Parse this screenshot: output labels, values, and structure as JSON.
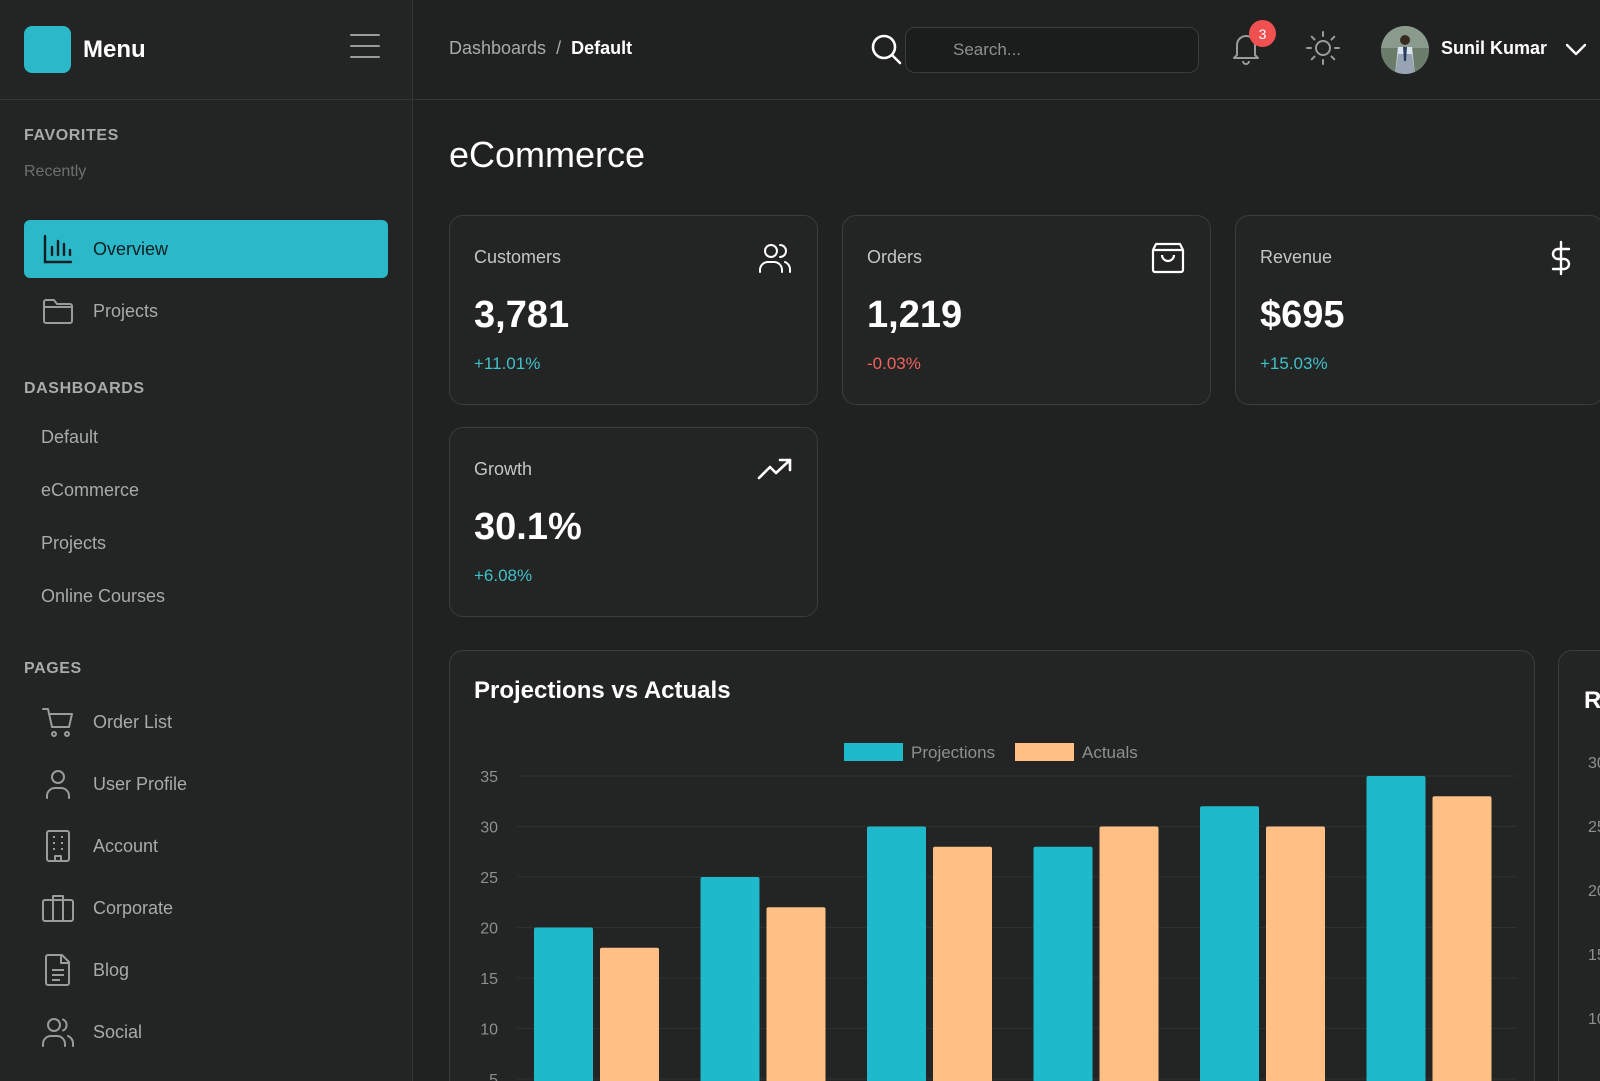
{
  "sidebar": {
    "title": "Menu",
    "favorites": {
      "label": "FAVORITES",
      "sub": "Recently"
    },
    "top_items": [
      {
        "label": "Overview",
        "icon": "bar-chart-icon"
      },
      {
        "label": "Projects",
        "icon": "folder-icon"
      }
    ],
    "dashboards": {
      "label": "DASHBOARDS",
      "items": [
        "Default",
        "eCommerce",
        "Projects",
        "Online Courses"
      ]
    },
    "pages": {
      "label": "PAGES",
      "items": [
        {
          "label": "Order List",
          "icon": "cart-icon"
        },
        {
          "label": "User Profile",
          "icon": "user-icon"
        },
        {
          "label": "Account",
          "icon": "building-icon"
        },
        {
          "label": "Corporate",
          "icon": "briefcase-icon"
        },
        {
          "label": "Blog",
          "icon": "document-icon"
        },
        {
          "label": "Social",
          "icon": "users-icon"
        }
      ]
    }
  },
  "header": {
    "breadcrumb": {
      "parent": "Dashboards",
      "separator": "/",
      "current": "Default"
    },
    "search_placeholder": "Search...",
    "notification_count": "3",
    "user_name": "Sunil Kumar"
  },
  "main": {
    "title": "eCommerce",
    "cards": [
      {
        "label": "Customers",
        "value": "3,781",
        "change": "+11.01%",
        "trend": "up",
        "icon": "users-icon"
      },
      {
        "label": "Orders",
        "value": "1,219",
        "change": "-0.03%",
        "trend": "down",
        "icon": "shopping-bag-icon"
      },
      {
        "label": "Revenue",
        "value": "$695",
        "change": "+15.03%",
        "trend": "up",
        "icon": "dollar-icon"
      },
      {
        "label": "Growth",
        "value": "30.1%",
        "change": "+6.08%",
        "trend": "up",
        "icon": "trending-up-icon"
      }
    ],
    "side_card": {
      "title": "R",
      "ticks": [
        "30",
        "25",
        "20",
        "15",
        "10"
      ]
    }
  },
  "colors": {
    "accent": "#2bb8c8",
    "projections": "#1fb9cc",
    "actuals": "#ffbf85",
    "positive": "#3fc1c9",
    "negative": "#f0625a"
  },
  "chart_data": {
    "type": "bar",
    "title": "Projections vs Actuals",
    "categories": [
      "",
      "",
      "",
      "",
      "",
      ""
    ],
    "series": [
      {
        "name": "Projections",
        "values": [
          20,
          25,
          30,
          28,
          32,
          35
        ]
      },
      {
        "name": "Actuals",
        "values": [
          18,
          22,
          28,
          30,
          30,
          33
        ]
      }
    ],
    "yticks": [
      35,
      30,
      25,
      20,
      15,
      10,
      5
    ],
    "ylim": [
      0,
      35
    ],
    "legend_position": "top-center",
    "grid": true
  }
}
